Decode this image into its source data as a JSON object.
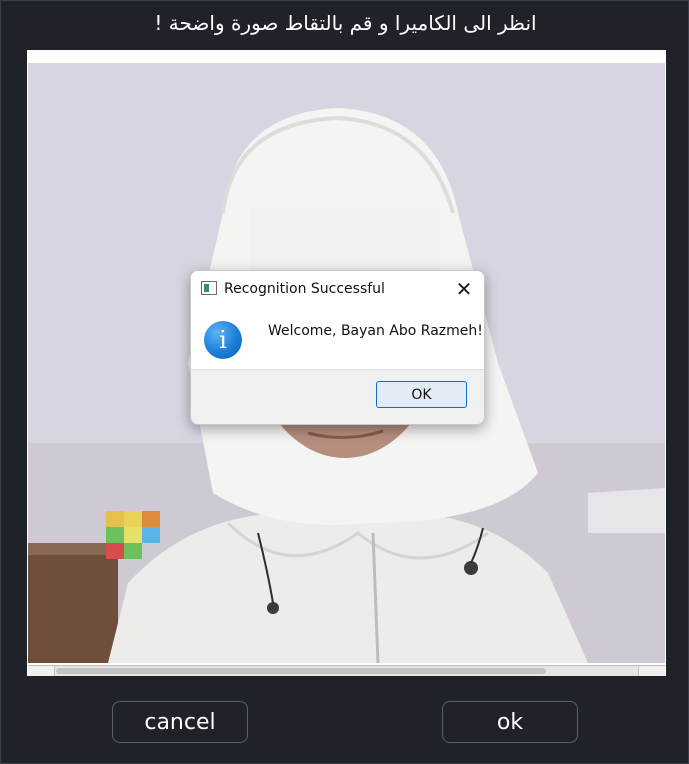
{
  "dialog": {
    "title": "انظر الى الكاميرا و قم بالتقاط صورة واضحة !"
  },
  "camera": {
    "content": "webcam-photo"
  },
  "buttons": {
    "cancel_label": "cancel",
    "ok_label": "ok"
  },
  "message_box": {
    "title": "Recognition Successful",
    "close_glyph": "✕",
    "icon": "info-icon",
    "icon_glyph": "i",
    "message": "Welcome, Bayan Abo Razmeh!",
    "ok_label": "OK"
  }
}
